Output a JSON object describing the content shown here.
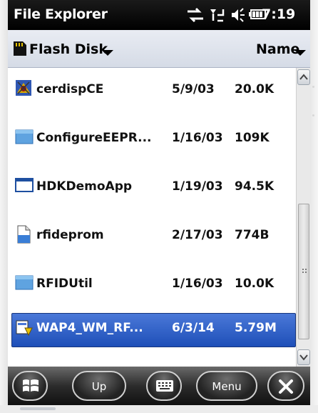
{
  "titlebar": {
    "title": "File Explorer",
    "clock": "7:19",
    "status_icons": [
      "connectivity-icon",
      "signal-icon",
      "volume-icon",
      "battery-icon"
    ]
  },
  "folderbar": {
    "folder": "Flash Disk",
    "sort": "Name"
  },
  "files": [
    {
      "name": "cerdispCE",
      "date": "5/9/03",
      "size": "20.0K",
      "icon": "app-icon",
      "selected": false
    },
    {
      "name": "ConfigureEEPR...",
      "date": "1/16/03",
      "size": "109K",
      "icon": "folder-icon",
      "selected": false
    },
    {
      "name": "HDKDemoApp",
      "date": "1/19/03",
      "size": "94.5K",
      "icon": "window-icon",
      "selected": false
    },
    {
      "name": "rfideprom",
      "date": "2/17/03",
      "size": "774B",
      "icon": "document-icon",
      "selected": false
    },
    {
      "name": "RFIDUtil",
      "date": "1/16/03",
      "size": "10.0K",
      "icon": "folder-icon",
      "selected": false
    },
    {
      "name": "WAP4_WM_RF...",
      "date": "6/3/14",
      "size": "5.79M",
      "icon": "installer-icon",
      "selected": true
    }
  ],
  "softkeys": {
    "start": "windows-start-icon",
    "up": "Up",
    "keyboard": "keyboard-icon",
    "menu": "Menu",
    "close": "close-icon"
  },
  "colors": {
    "selection": "#2a5cc6",
    "titlebar": "#000000"
  }
}
